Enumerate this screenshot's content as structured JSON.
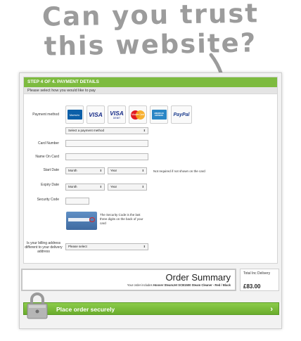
{
  "headline": {
    "line1": "Can you trust",
    "line2": "this website?"
  },
  "step": {
    "title": "STEP 4 OF 4. PAYMENT DETAILS",
    "subtitle": "Please select how you would like to pay"
  },
  "form": {
    "payment_method_label": "Payment method",
    "card_type_options": [
      "Maestro",
      "VISA",
      "VISA",
      "MasterCard",
      "AMERICAN EXPRESS",
      "PayPal"
    ],
    "visa_debit_sublabel": "DEBIT",
    "select_payment_method": "Select a payment method",
    "card_number_label": "Card Number",
    "name_on_card_label": "Name On Card",
    "start_date_label": "Start Date",
    "expiry_date_label": "Expiry Date",
    "month_placeholder": "Month",
    "year_placeholder": "Year",
    "start_date_note": "Not required if not shown on the card",
    "security_code_label": "Security Code",
    "security_code_help": "The Security Code is the last three digits on the back of your card",
    "billing_label": "Is your billing address different to your delivery address",
    "billing_select": "Please select"
  },
  "summary": {
    "title": "Order Summary",
    "detail_prefix": "Your order includes",
    "detail_item": "Hoover SteamJet SCB1500 Steam Cleaner - Red / Black",
    "total_label": "Total Inc Delivery",
    "total_amount": "£83.00"
  },
  "action": {
    "place_order": "Place order securely",
    "chevron": "›"
  },
  "colors": {
    "accent_green": "#7dbb3f",
    "arrow_gray": "#9c9c9c"
  }
}
